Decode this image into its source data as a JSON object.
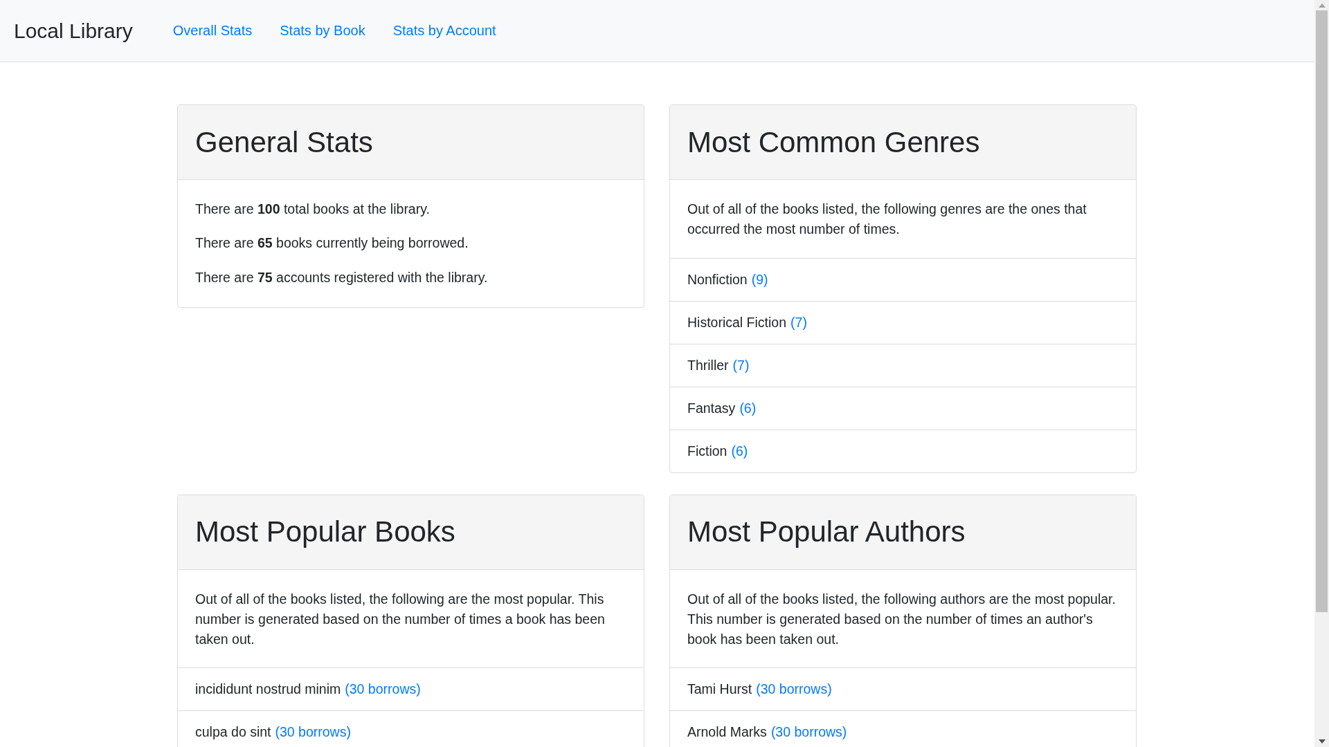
{
  "navbar": {
    "brand": "Local Library",
    "links": [
      {
        "label": "Overall Stats"
      },
      {
        "label": "Stats by Book"
      },
      {
        "label": "Stats by Account"
      }
    ]
  },
  "cards": [
    {
      "kind": "stats",
      "title": "General Stats",
      "lines": [
        "There are **100** total books at the library.",
        "There are **65** books currently being borrowed.",
        "There are **75** accounts registered with the library."
      ]
    },
    {
      "kind": "list",
      "title": "Most Common Genres",
      "description": "Out of all of the books listed, the following genres are the ones that occurred the most number of times.",
      "items": [
        {
          "name": "Nonfiction",
          "count": "(9)"
        },
        {
          "name": "Historical Fiction",
          "count": "(7)"
        },
        {
          "name": "Thriller",
          "count": "(7)"
        },
        {
          "name": "Fantasy",
          "count": "(6)"
        },
        {
          "name": "Fiction",
          "count": "(6)"
        }
      ]
    },
    {
      "kind": "list",
      "title": "Most Popular Books",
      "description": "Out of all of the books listed, the following are the most popular. This number is generated based on the number of times a book has been taken out.",
      "items": [
        {
          "name": "incididunt nostrud minim",
          "count": "(30 borrows)"
        },
        {
          "name": "culpa do sint",
          "count": "(30 borrows)"
        }
      ]
    },
    {
      "kind": "list",
      "title": "Most Popular Authors",
      "description": "Out of all of the books listed, the following authors are the most popular. This number is generated based on the number of times an author's book has been taken out.",
      "items": [
        {
          "name": "Tami Hurst",
          "count": "(30 borrows)"
        },
        {
          "name": "Arnold Marks",
          "count": "(30 borrows)"
        }
      ]
    }
  ]
}
